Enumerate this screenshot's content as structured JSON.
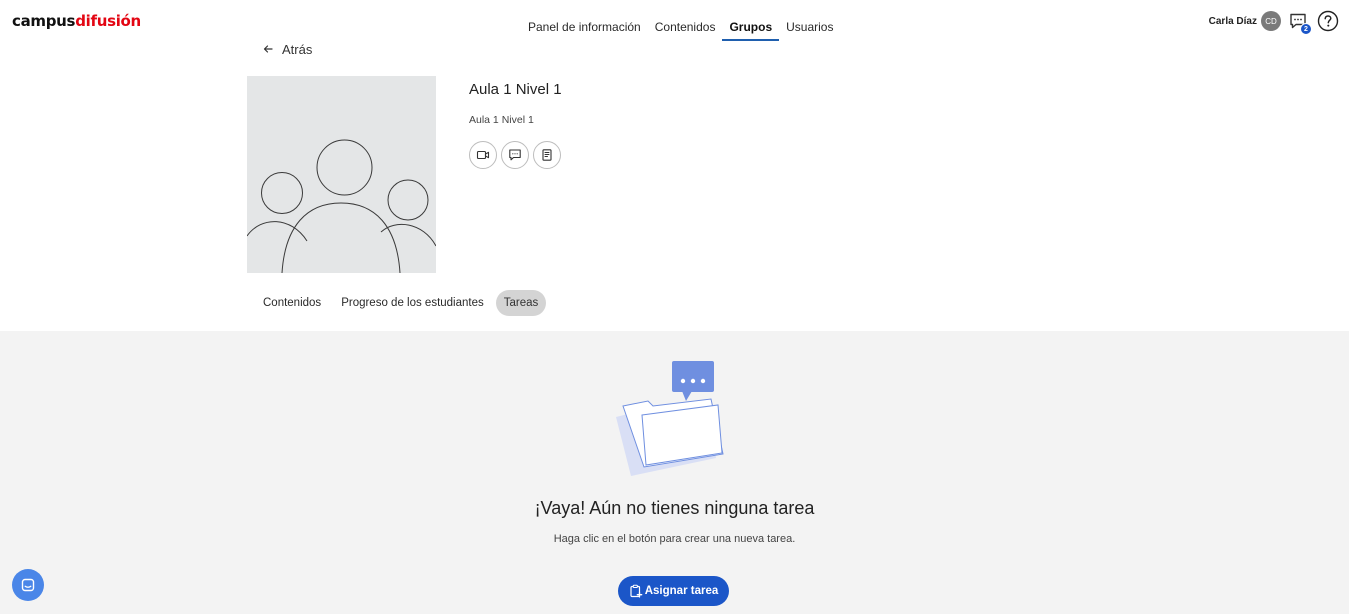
{
  "brand": {
    "part1": "campus",
    "part2": "difusión",
    "color_dark": "#111111",
    "color_red": "#e30613"
  },
  "topnav": {
    "items": [
      {
        "label": "Panel de información",
        "active": false
      },
      {
        "label": "Contenidos",
        "active": false
      },
      {
        "label": "Grupos",
        "active": true
      },
      {
        "label": "Usuarios",
        "active": false
      }
    ]
  },
  "user": {
    "name": "Carla Díaz",
    "initials": "CD",
    "messages_badge": "2"
  },
  "back": {
    "label": "Atrás"
  },
  "group": {
    "title": "Aula 1 Nivel 1",
    "subtitle": "Aula 1 Nivel 1",
    "actions": [
      {
        "icon": "video-camera-icon"
      },
      {
        "icon": "chat-icon"
      },
      {
        "icon": "document-icon"
      }
    ]
  },
  "tabs": [
    {
      "label": "Contenidos",
      "active": false
    },
    {
      "label": "Progreso de los estudiantes",
      "active": false
    },
    {
      "label": "Tareas",
      "active": true
    }
  ],
  "empty_state": {
    "title": "¡Vaya! Aún no tienes ninguna tarea",
    "subtitle": "Haga clic en el botón para crear una nueva tarea.",
    "button_label": "Asignar tarea"
  },
  "colors": {
    "accent": "#1b56c8",
    "nav_underline": "#1f5fae",
    "gray_bg": "#f3f3f3"
  }
}
